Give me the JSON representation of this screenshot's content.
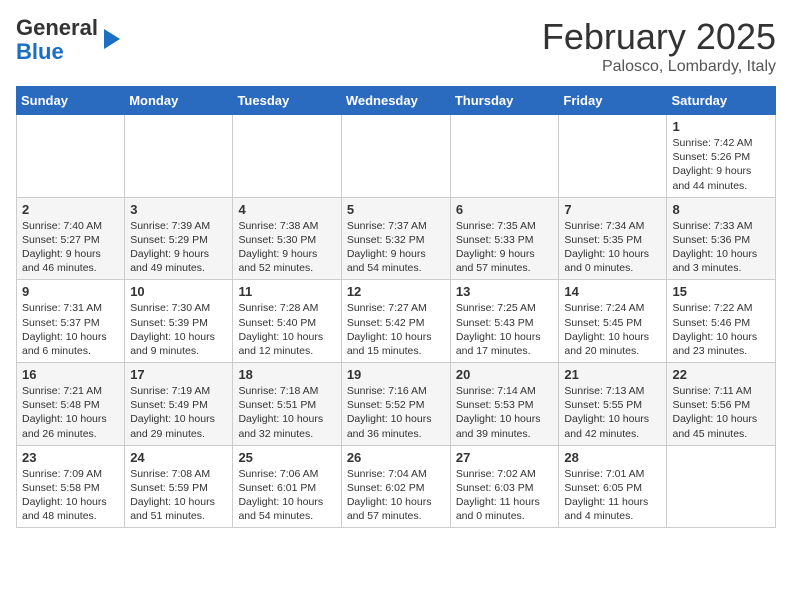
{
  "header": {
    "logo_general": "General",
    "logo_blue": "Blue",
    "month": "February 2025",
    "location": "Palosco, Lombardy, Italy"
  },
  "days_of_week": [
    "Sunday",
    "Monday",
    "Tuesday",
    "Wednesday",
    "Thursday",
    "Friday",
    "Saturday"
  ],
  "weeks": [
    [
      {
        "day": "",
        "info": ""
      },
      {
        "day": "",
        "info": ""
      },
      {
        "day": "",
        "info": ""
      },
      {
        "day": "",
        "info": ""
      },
      {
        "day": "",
        "info": ""
      },
      {
        "day": "",
        "info": ""
      },
      {
        "day": "1",
        "info": "Sunrise: 7:42 AM\nSunset: 5:26 PM\nDaylight: 9 hours and 44 minutes."
      }
    ],
    [
      {
        "day": "2",
        "info": "Sunrise: 7:40 AM\nSunset: 5:27 PM\nDaylight: 9 hours and 46 minutes."
      },
      {
        "day": "3",
        "info": "Sunrise: 7:39 AM\nSunset: 5:29 PM\nDaylight: 9 hours and 49 minutes."
      },
      {
        "day": "4",
        "info": "Sunrise: 7:38 AM\nSunset: 5:30 PM\nDaylight: 9 hours and 52 minutes."
      },
      {
        "day": "5",
        "info": "Sunrise: 7:37 AM\nSunset: 5:32 PM\nDaylight: 9 hours and 54 minutes."
      },
      {
        "day": "6",
        "info": "Sunrise: 7:35 AM\nSunset: 5:33 PM\nDaylight: 9 hours and 57 minutes."
      },
      {
        "day": "7",
        "info": "Sunrise: 7:34 AM\nSunset: 5:35 PM\nDaylight: 10 hours and 0 minutes."
      },
      {
        "day": "8",
        "info": "Sunrise: 7:33 AM\nSunset: 5:36 PM\nDaylight: 10 hours and 3 minutes."
      }
    ],
    [
      {
        "day": "9",
        "info": "Sunrise: 7:31 AM\nSunset: 5:37 PM\nDaylight: 10 hours and 6 minutes."
      },
      {
        "day": "10",
        "info": "Sunrise: 7:30 AM\nSunset: 5:39 PM\nDaylight: 10 hours and 9 minutes."
      },
      {
        "day": "11",
        "info": "Sunrise: 7:28 AM\nSunset: 5:40 PM\nDaylight: 10 hours and 12 minutes."
      },
      {
        "day": "12",
        "info": "Sunrise: 7:27 AM\nSunset: 5:42 PM\nDaylight: 10 hours and 15 minutes."
      },
      {
        "day": "13",
        "info": "Sunrise: 7:25 AM\nSunset: 5:43 PM\nDaylight: 10 hours and 17 minutes."
      },
      {
        "day": "14",
        "info": "Sunrise: 7:24 AM\nSunset: 5:45 PM\nDaylight: 10 hours and 20 minutes."
      },
      {
        "day": "15",
        "info": "Sunrise: 7:22 AM\nSunset: 5:46 PM\nDaylight: 10 hours and 23 minutes."
      }
    ],
    [
      {
        "day": "16",
        "info": "Sunrise: 7:21 AM\nSunset: 5:48 PM\nDaylight: 10 hours and 26 minutes."
      },
      {
        "day": "17",
        "info": "Sunrise: 7:19 AM\nSunset: 5:49 PM\nDaylight: 10 hours and 29 minutes."
      },
      {
        "day": "18",
        "info": "Sunrise: 7:18 AM\nSunset: 5:51 PM\nDaylight: 10 hours and 32 minutes."
      },
      {
        "day": "19",
        "info": "Sunrise: 7:16 AM\nSunset: 5:52 PM\nDaylight: 10 hours and 36 minutes."
      },
      {
        "day": "20",
        "info": "Sunrise: 7:14 AM\nSunset: 5:53 PM\nDaylight: 10 hours and 39 minutes."
      },
      {
        "day": "21",
        "info": "Sunrise: 7:13 AM\nSunset: 5:55 PM\nDaylight: 10 hours and 42 minutes."
      },
      {
        "day": "22",
        "info": "Sunrise: 7:11 AM\nSunset: 5:56 PM\nDaylight: 10 hours and 45 minutes."
      }
    ],
    [
      {
        "day": "23",
        "info": "Sunrise: 7:09 AM\nSunset: 5:58 PM\nDaylight: 10 hours and 48 minutes."
      },
      {
        "day": "24",
        "info": "Sunrise: 7:08 AM\nSunset: 5:59 PM\nDaylight: 10 hours and 51 minutes."
      },
      {
        "day": "25",
        "info": "Sunrise: 7:06 AM\nSunset: 6:01 PM\nDaylight: 10 hours and 54 minutes."
      },
      {
        "day": "26",
        "info": "Sunrise: 7:04 AM\nSunset: 6:02 PM\nDaylight: 10 hours and 57 minutes."
      },
      {
        "day": "27",
        "info": "Sunrise: 7:02 AM\nSunset: 6:03 PM\nDaylight: 11 hours and 0 minutes."
      },
      {
        "day": "28",
        "info": "Sunrise: 7:01 AM\nSunset: 6:05 PM\nDaylight: 11 hours and 4 minutes."
      },
      {
        "day": "",
        "info": ""
      }
    ]
  ]
}
